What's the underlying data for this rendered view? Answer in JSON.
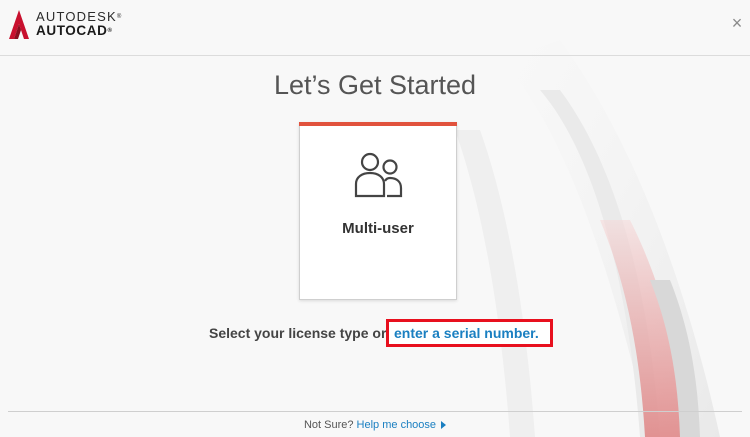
{
  "header": {
    "brand_line1": "AUTODESK",
    "brand_line1_mark": "®",
    "brand_line2": "AUTOCAD",
    "brand_line2_mark": "®",
    "close_glyph": "×"
  },
  "title": "Let’s Get Started",
  "license_option": {
    "label": "Multi-user",
    "icon": "users-icon",
    "accent_color": "#e1523d"
  },
  "prompt": {
    "text": "Select your license type or",
    "link": "enter a serial number.",
    "highlight_color": "#e8101e"
  },
  "footer": {
    "text": "Not Sure?",
    "link": "Help me choose"
  },
  "colors": {
    "brand_red": "#c8102e",
    "link_blue": "#1a7fc1"
  }
}
